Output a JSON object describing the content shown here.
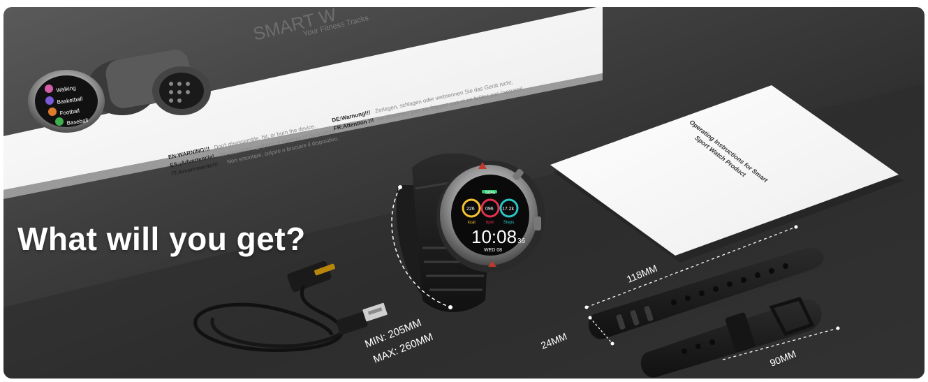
{
  "headline": "What will you get?",
  "box": {
    "brand": "SMART W",
    "tagline": "Your Fitness Tracks",
    "sports": [
      "Walking",
      "Basketball",
      "Football",
      "Baseball"
    ],
    "warnings": [
      {
        "lang": "EN:WARNING!!!",
        "text": "Don't disassemble, hit, or burn the device."
      },
      {
        "lang": "ES:¡Advertencia!",
        "text": "No desarmes, golpees ni quemes el dispositivo."
      },
      {
        "lang": "IT:Avvertimento!!!",
        "text": "Non smontare, colpire o bruciare il dispositivo."
      },
      {
        "lang": "DE:Warnung!!!",
        "text": "Zerlegen, schlagen oder verbrennen Sie das Gerät nicht."
      },
      {
        "lang": "FR:Attention !!!",
        "text": "Ne démontez pas, ne frappez pas et ne brûlez pas l'appareil."
      }
    ]
  },
  "manual": {
    "title_line1": "Operating Instructions for Smart",
    "title_line2": "Sport Watch Product"
  },
  "watch": {
    "time": "10:08",
    "seconds": "36",
    "date": "WED 08",
    "battery": "50%",
    "metrics": [
      {
        "value": "226",
        "label": "kcal"
      },
      {
        "value": "096",
        "label": "bpm"
      },
      {
        "value": "17.2k",
        "label": "Steps"
      }
    ]
  },
  "dimensions": {
    "strap_min": "MIN: 205MM",
    "strap_max": "MAX: 260MM",
    "long_strap": "118MM",
    "short_strap": "90MM",
    "width": "24MM"
  },
  "colors": {
    "background": "#3a3a3a",
    "text": "#ffffff",
    "box": "#f2f2f2",
    "accent": "#c0392b"
  }
}
